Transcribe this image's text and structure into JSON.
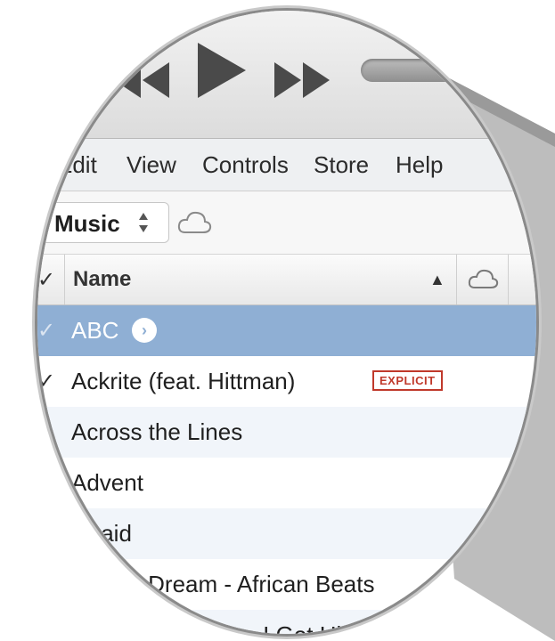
{
  "menu": {
    "items": [
      "Edit",
      "View",
      "Controls",
      "Store",
      "Help"
    ]
  },
  "toolbar": {
    "source_label": "Music"
  },
  "column_header": {
    "check": "✓",
    "name": "Name",
    "sort_indicator": "▲"
  },
  "rows": [
    {
      "check": "✓",
      "name": "ABC",
      "selected": true,
      "explicit": ""
    },
    {
      "check": "✓",
      "name": "Ackrite (feat. Hittman)",
      "selected": false,
      "explicit": "EXPLICIT"
    },
    {
      "check": "✓",
      "name": "Across the Lines",
      "selected": false,
      "explicit": ""
    },
    {
      "check": "✓",
      "name": "Advent",
      "selected": false,
      "explicit": ""
    },
    {
      "check": "",
      "name": "Afraid",
      "selected": false,
      "explicit": ""
    },
    {
      "check": "",
      "name": "African Dream - African Beats",
      "selected": false,
      "explicit": ""
    },
    {
      "check": "",
      "name": "…use I Got Hi…",
      "selected": false,
      "explicit": ""
    }
  ],
  "icons": {
    "prev": "previous-track-icon",
    "play": "play-icon",
    "next": "next-track-icon",
    "cloud": "cloud-icon",
    "arrow": "go-arrow-icon",
    "music": "music-note-icon"
  },
  "colors": {
    "selected_row": "#8fafd4",
    "explicit": "#c0392b",
    "alt_row": "#f1f5fa"
  }
}
